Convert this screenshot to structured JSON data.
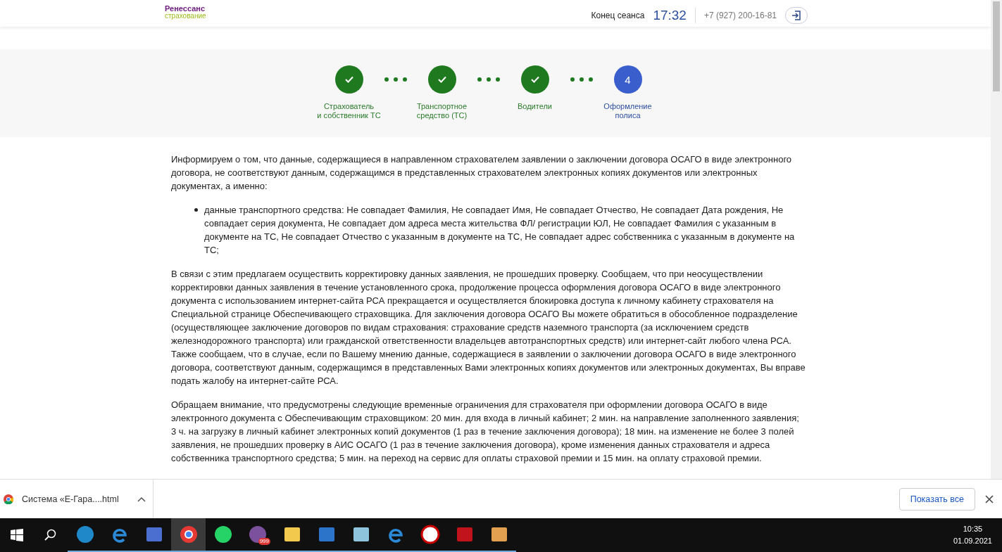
{
  "header": {
    "logo_name": "Ренессанс",
    "logo_sub": "страхование",
    "session_label": "Конец сеанса",
    "session_time": "17:32",
    "phone": "+7 (927) 200-16-81"
  },
  "steps": [
    {
      "label": "Страхователь\nи собственник ТС",
      "done": true
    },
    {
      "label": "Транспортное\nсредство (ТС)",
      "done": true
    },
    {
      "label": "Водители",
      "done": true
    },
    {
      "label": "Оформление\nполиса",
      "done": false,
      "number": "4"
    }
  ],
  "content": {
    "intro": "Информируем о том, что данные, содержащиеся в направленном страхователем заявлении о заключении договора ОСАГО в виде электронного договора, не соответствуют данным, содержащимся в представленных страхователем электронных копиях документов или электронных документах, а именно:",
    "mismatches": [
      "данные транспортного средства: Не совпадает Фамилия, Не совпадает Имя, Не совпадает Отчество, Не совпадает Дата рождения, Не совпадает серия документа, Не совпадает дом адреса места жительства ФЛ/ регистрации ЮЛ, Не совпадает Фамилия с указанным в документе на ТС, Не совпадает Отчество с указанным в документе на ТС, Не совпадает адрес собственника с указанным в документе на ТС;"
    ],
    "paragraphs": [
      "В связи с этим предлагаем осуществить корректировку данных заявления, не прошедших проверку. Сообщаем, что при неосуществлении корректировки данных заявления в течение установленного срока, продолжение процесса оформления договора ОСАГО в виде электронного документа с использованием интернет-сайта РСА прекращается и осуществляется блокировка доступа к личному кабинету страхователя на Специальной странице Обеспечивающего страховщика. Для заключения договора ОСАГО Вы можете обратиться в обособленное подразделение (осуществляющее заключение договоров по видам страхования: страхование средств наземного транспорта (за исключением средств железнодорожного транспорта) или гражданской ответственности владельцев автотранспортных средств) или интернет-сайт любого члена РСА. Также сообщаем, что в случае, если по Вашему мнению данные, содержащиеся в заявлении о заключении договора ОСАГО в виде электронного договора, соответствуют данным, содержащимся в представленных Вами электронных копиях документов или электронных документах, Вы вправе подать жалобу на интернет-сайте РСА.",
      "Обращаем внимание, что предусмотрены следующие временные ограничения для страхователя при оформлении договора ОСАГО в виде электронного документа с Обеспечивающим страховщиком: 20 мин. для входа в личный кабинет; 2 мин. на направление заполненного заявления; 3 ч. на загрузку в личный кабинет электронных копий документов (1 раз в течение заключения договора); 18 мин. на изменение не более 3 полей заявления, не прошедших проверку в АИС ОСАГО (1 раз в течение заключения договора), кроме изменения данных страхователя и адреса собственника транспортного средства; 5 мин. на переход на сервис для оплаты страховой премии и 15 мин. на оплату страховой премии."
    ]
  },
  "download_bar": {
    "file_name": "Система «Е-Гара....html",
    "show_all": "Показать все"
  },
  "taskbar": {
    "apps": [
      {
        "kind": "edge",
        "active": false
      },
      {
        "kind": "ie",
        "active": false
      },
      {
        "kind": "app",
        "active": false
      },
      {
        "kind": "chrome",
        "active": true
      },
      {
        "kind": "whatsapp",
        "active": false
      },
      {
        "kind": "viber",
        "active": false,
        "badge": "999"
      },
      {
        "kind": "folder",
        "active": false
      },
      {
        "kind": "photos",
        "active": false
      },
      {
        "kind": "app2",
        "active": false
      },
      {
        "kind": "ie",
        "active": false
      },
      {
        "kind": "osago",
        "active": false
      },
      {
        "kind": "pdf",
        "active": false
      },
      {
        "kind": "paint",
        "active": false
      }
    ],
    "time": "10:35",
    "date": "01.09.2021"
  }
}
